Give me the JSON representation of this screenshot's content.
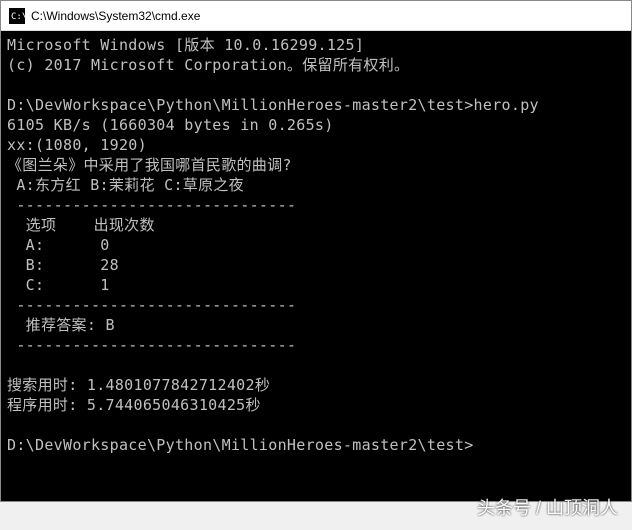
{
  "window": {
    "title": "C:\\Windows\\System32\\cmd.exe"
  },
  "terminal": {
    "header1": "Microsoft Windows [版本 10.0.16299.125]",
    "header2": "(c) 2017 Microsoft Corporation。保留所有权利。",
    "prompt1": "D:\\DevWorkspace\\Python\\MillionHeroes-master2\\test>hero.py",
    "speed": "6105 KB/s (1660304 bytes in 0.265s)",
    "xx": "xx:(1080, 1920)",
    "question": "《图兰朵》中采用了我国哪首民歌的曲调?",
    "options": " A:东方红 B:茉莉花 C:草原之夜",
    "divider": " ------------------------------",
    "table_header": "  选项    出现次数",
    "row_a": "  A:      0",
    "row_b": "  B:      28",
    "row_c": "  C:      1",
    "recommend": "  推荐答案: B",
    "search_time": "搜索用时: 1.4801077842712402秒",
    "program_time": "程序用时: 5.744065046310425秒",
    "prompt2": "D:\\DevWorkspace\\Python\\MillionHeroes-master2\\test>"
  },
  "watermark": "头条号 / 山顶洞人"
}
